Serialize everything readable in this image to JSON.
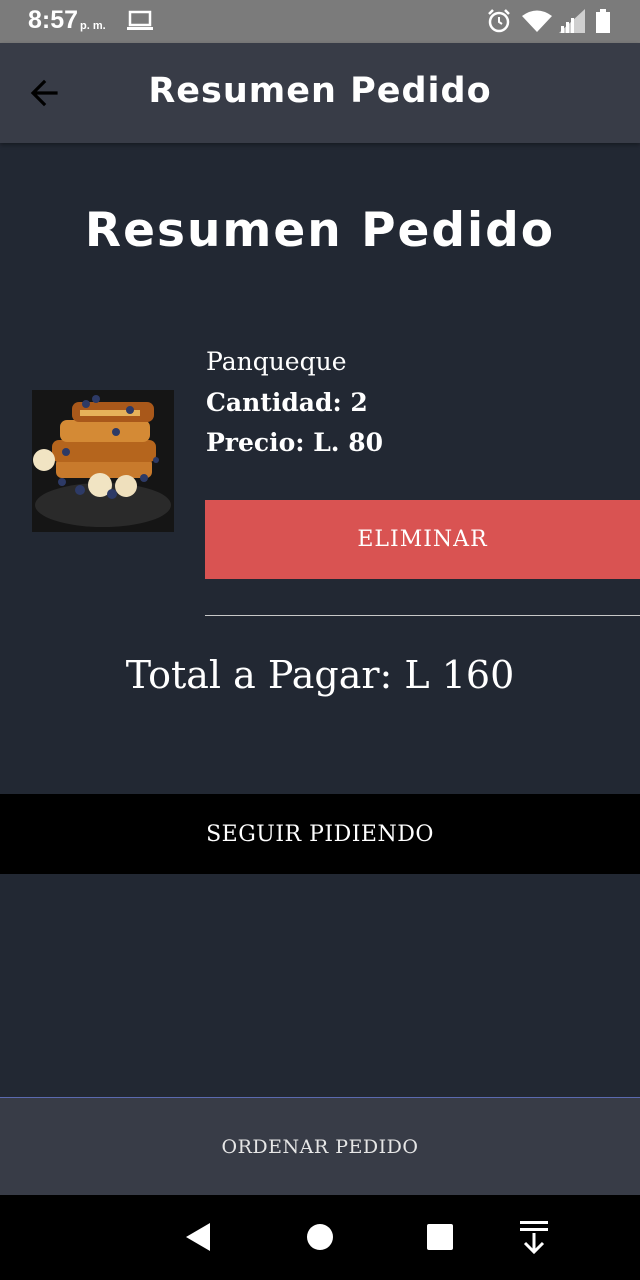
{
  "status_bar": {
    "time": "8:57",
    "ampm": "p. m.",
    "icons": [
      "laptop-icon",
      "alarm-icon",
      "wifi-icon",
      "signal-icon",
      "battery-icon"
    ]
  },
  "app_bar": {
    "title": "Resumen Pedido",
    "back_icon": "arrow-left-icon"
  },
  "page_title": "Resumen Pedido",
  "order_item": {
    "name": "Panqueque",
    "quantity": "Cantidad: 2",
    "price": "Precio: L. 80",
    "remove_label": "ELIMINAR"
  },
  "total": "Total a Pagar: L 160",
  "continue_label": "SEGUIR PIDIENDO",
  "order_label": "ORDENAR PEDIDO",
  "nav_bar": [
    "back-triangle-icon",
    "home-circle-icon",
    "recents-square-icon",
    "notifications-pull-icon"
  ],
  "colors": {
    "background": "#222833",
    "app_bar": "#383c47",
    "remove_button": "#d95352",
    "continue_button": "#000000",
    "status_bar": "#7b7b7b"
  }
}
